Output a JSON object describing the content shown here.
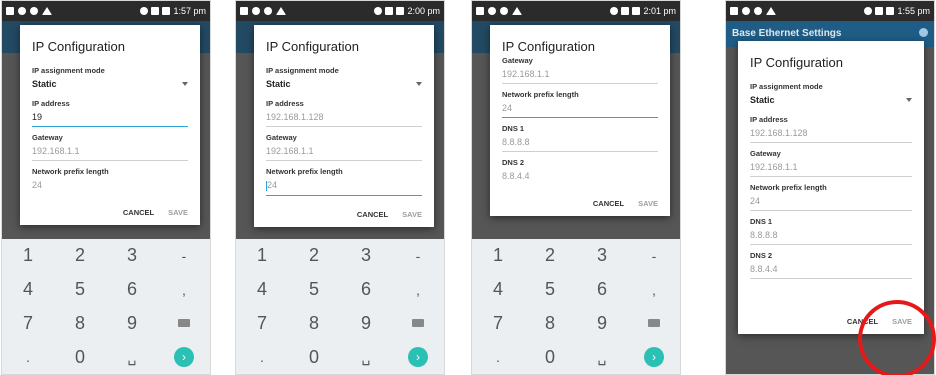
{
  "panels": [
    {
      "status_time": "1:57 pm",
      "dialog": {
        "title": "IP Configuration",
        "mode_label": "IP assignment mode",
        "mode_value": "Static",
        "fields": [
          {
            "label": "IP address",
            "value": "19",
            "style": "focus"
          },
          {
            "label": "Gateway",
            "value": "192.168.1.1",
            "style": "dim"
          },
          {
            "label": "Network prefix length",
            "value": "24",
            "style": "dim"
          }
        ],
        "cancel": "CANCEL",
        "save": "SAVE"
      }
    },
    {
      "status_time": "2:00 pm",
      "dialog": {
        "title": "IP Configuration",
        "mode_label": "IP assignment mode",
        "mode_value": "Static",
        "fields": [
          {
            "label": "IP address",
            "value": "192.168.1.128",
            "style": "dim"
          },
          {
            "label": "Gateway",
            "value": "192.168.1.1",
            "style": "dim"
          },
          {
            "label": "Network prefix length",
            "value": "24",
            "style": "focus"
          }
        ],
        "cancel": "CANCEL",
        "save": "SAVE"
      }
    },
    {
      "status_time": "2:01 pm",
      "dialog": {
        "title": "IP Configuration",
        "fields": [
          {
            "label": "Gateway",
            "value": "192.168.1.1",
            "style": "dim"
          },
          {
            "label": "Network prefix length",
            "value": "24",
            "style": "focus"
          },
          {
            "label": "DNS 1",
            "value": "8.8.8.8",
            "style": "dim"
          },
          {
            "label": "DNS 2",
            "value": "8.8.4.4",
            "style": "dim"
          }
        ],
        "cancel": "CANCEL",
        "save": "SAVE"
      }
    },
    {
      "status_time": "1:55 pm",
      "appbar_title": "Base Ethernet Settings",
      "dialog": {
        "title": "IP Configuration",
        "mode_label": "IP assignment mode",
        "mode_value": "Static",
        "fields": [
          {
            "label": "IP address",
            "value": "192.168.1.128",
            "style": "dim"
          },
          {
            "label": "Gateway",
            "value": "192.168.1.1",
            "style": "dim"
          },
          {
            "label": "Network prefix length",
            "value": "24",
            "style": "dim"
          },
          {
            "label": "DNS 1",
            "value": "8.8.8.8",
            "style": "dim"
          },
          {
            "label": "DNS 2",
            "value": "8.8.4.4",
            "style": "dim"
          }
        ],
        "cancel": "CANCEL",
        "save": "SAVE"
      }
    }
  ],
  "keypad": {
    "keys": [
      "1",
      "2",
      "3",
      "-",
      "4",
      "5",
      "6",
      ",",
      "7",
      "8",
      "9",
      "backspace-icon",
      ".",
      "0",
      "space",
      "go-icon"
    ]
  },
  "colors": {
    "accent": "#2aa6d8",
    "annotation": "#e41a1a",
    "appbar": "#1f5d86"
  }
}
